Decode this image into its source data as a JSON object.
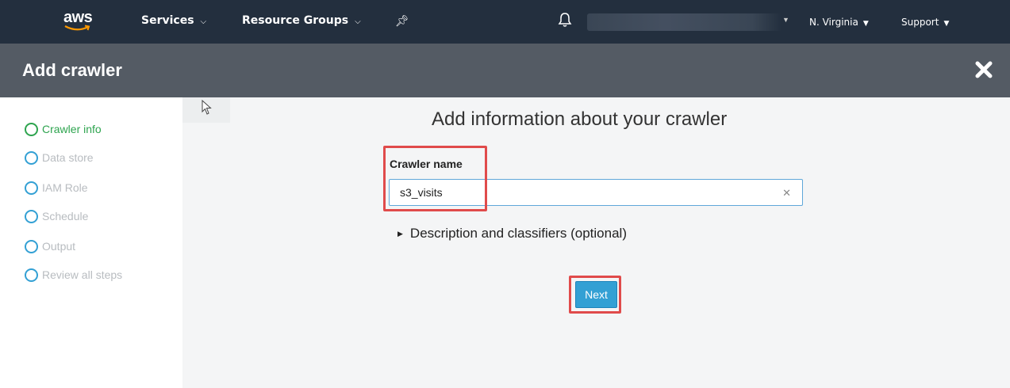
{
  "nav": {
    "logo_text": "aws",
    "services": "Services",
    "resource_groups": "Resource Groups",
    "region": "N. Virginia",
    "support": "Support"
  },
  "header": {
    "title": "Add crawler"
  },
  "sidebar": {
    "steps": [
      {
        "label": "Crawler info",
        "state": "active"
      },
      {
        "label": "Data store",
        "state": "pending"
      },
      {
        "label": "IAM Role",
        "state": "pending"
      },
      {
        "label": "Schedule",
        "state": "pending"
      },
      {
        "label": "Output",
        "state": "pending"
      },
      {
        "label": "Review all steps",
        "state": "pending"
      }
    ]
  },
  "main": {
    "heading": "Add information about your crawler",
    "crawler_name_label": "Crawler name",
    "crawler_name_value": "s3_visits",
    "description_toggle": "Description and classifiers (optional)",
    "next_label": "Next"
  },
  "colors": {
    "nav_bg": "#232f3e",
    "header_bg": "#545b64",
    "active_step": "#2ea44f",
    "step_circle": "#33a0d4",
    "primary_button": "#33a0d4",
    "highlight": "#e04b4b"
  },
  "icons": [
    "aws-logo-icon",
    "pin-icon",
    "bell-icon",
    "close-icon",
    "clear-input-icon",
    "caret-right-icon",
    "mouse-cursor-icon"
  ]
}
